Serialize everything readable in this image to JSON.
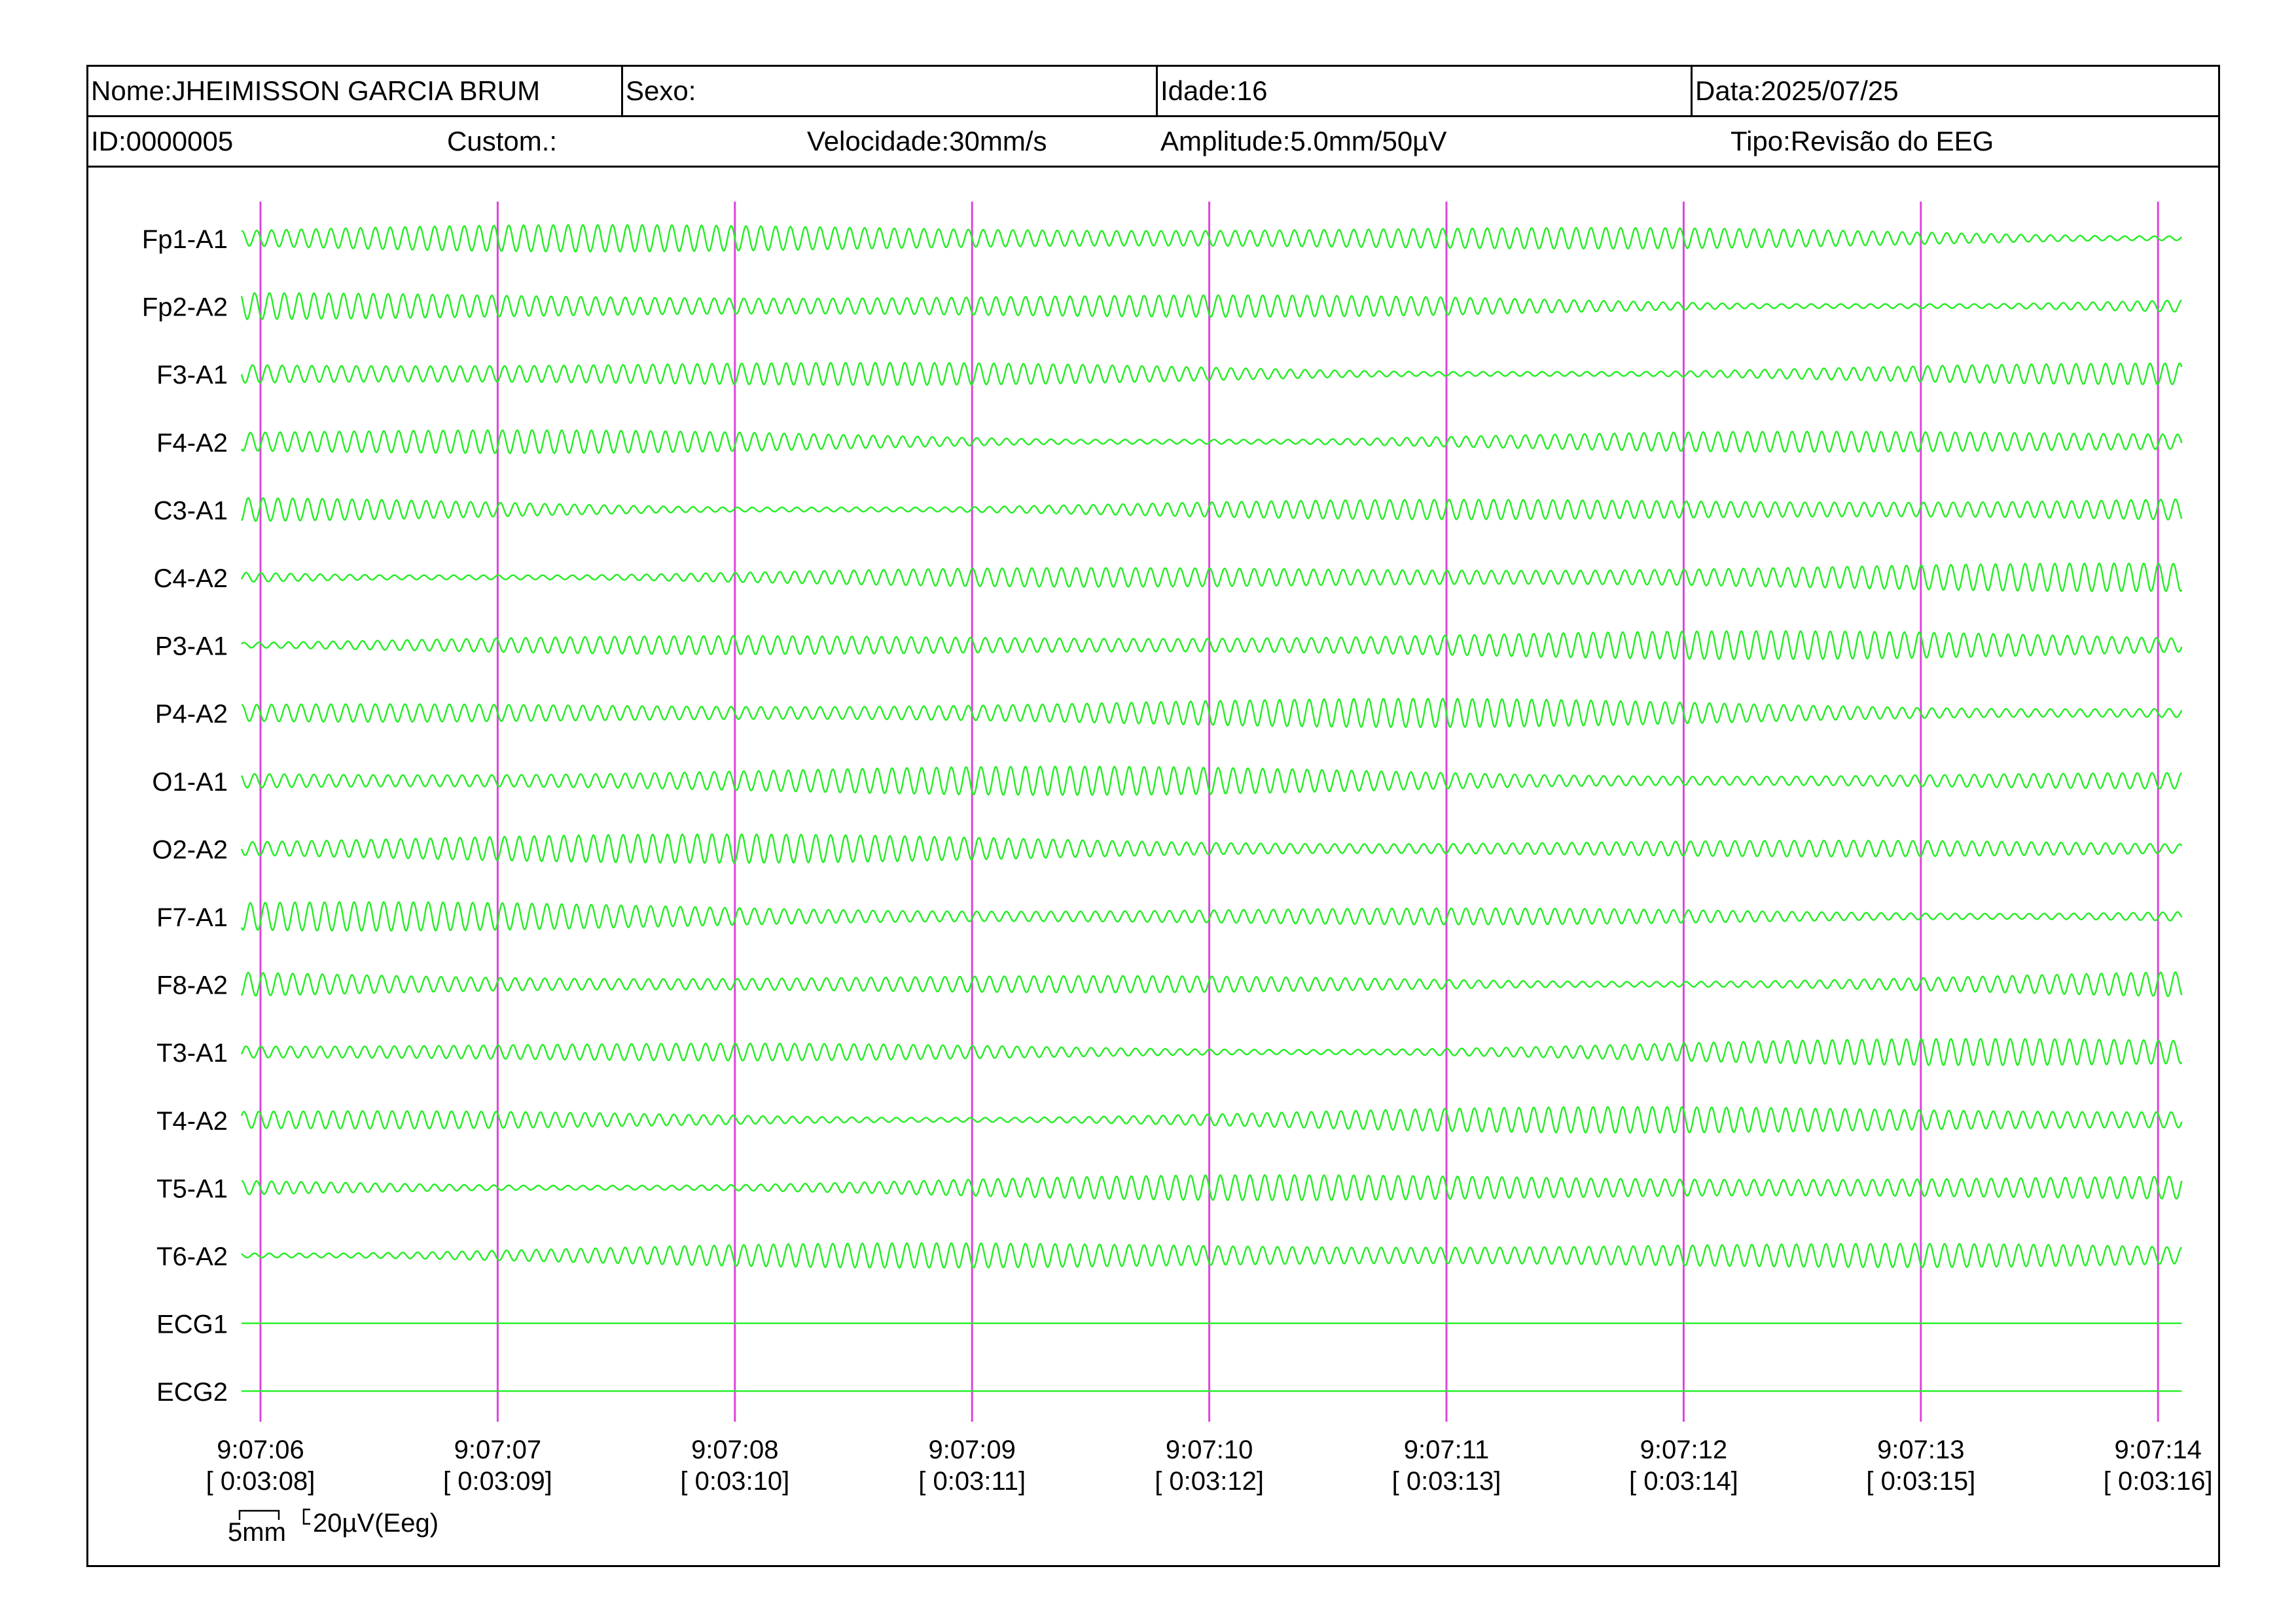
{
  "header": {
    "row1": [
      {
        "id": "name",
        "text": "Nome:JHEIMISSON GARCIA BRUM"
      },
      {
        "id": "sex",
        "text": "Sexo:"
      },
      {
        "id": "age",
        "text": "Idade:16"
      },
      {
        "id": "date",
        "text": "Data:2025/07/25"
      }
    ],
    "row2": [
      {
        "id": "patient-id",
        "text": "ID:0000005"
      },
      {
        "id": "custom",
        "text": "Custom.:"
      },
      {
        "id": "speed",
        "text": "Velocidade:30mm/s"
      },
      {
        "id": "amplitude",
        "text": "Amplitude:5.0mm/50µV"
      },
      {
        "id": "type",
        "text": "Tipo:Revisão do EEG"
      }
    ]
  },
  "colors": {
    "trace": "#22ee22",
    "marker": "#dd44dd",
    "text": "#000000",
    "background": "#ffffff"
  },
  "chart_data": {
    "type": "line",
    "channels": [
      "Fp1-A1",
      "Fp2-A2",
      "F3-A1",
      "F4-A2",
      "C3-A1",
      "C4-A2",
      "P3-A1",
      "P4-A2",
      "O1-A1",
      "O2-A2",
      "F7-A1",
      "F8-A2",
      "T3-A1",
      "T4-A2",
      "T5-A1",
      "T6-A2",
      "ECG1",
      "ECG2"
    ],
    "flat_channels": [
      "ECG1",
      "ECG2"
    ],
    "time_ticks": [
      {
        "clock": "9:07:06",
        "elapsed": "[ 0:03:08]"
      },
      {
        "clock": "9:07:07",
        "elapsed": "[ 0:03:09]"
      },
      {
        "clock": "9:07:08",
        "elapsed": "[ 0:03:10]"
      },
      {
        "clock": "9:07:09",
        "elapsed": "[ 0:03:11]"
      },
      {
        "clock": "9:07:10",
        "elapsed": "[ 0:03:12]"
      },
      {
        "clock": "9:07:11",
        "elapsed": "[ 0:03:13]"
      },
      {
        "clock": "9:07:12",
        "elapsed": "[ 0:03:14]"
      },
      {
        "clock": "9:07:13",
        "elapsed": "[ 0:03:15]"
      },
      {
        "clock": "9:07:14",
        "elapsed": "[ 0:03:16]"
      }
    ],
    "x_range_s": [
      0,
      8.1
    ],
    "oscillation_hz": 16,
    "scale_bar": {
      "time_label": "5mm",
      "amplitude_label": "20µV(Eeg)"
    }
  }
}
